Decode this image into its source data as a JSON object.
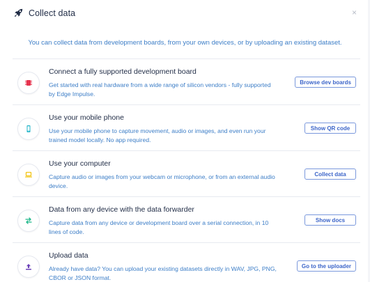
{
  "header": {
    "title": "Collect data",
    "close_glyph": "×",
    "icon": "rocket-icon"
  },
  "intro": "You can collect data from development boards, from your own devices, or by uploading an existing dataset.",
  "options": [
    {
      "title": "Connect a fully supported development board",
      "description": "Get started with real hardware from a wide range of silicon vendors - fully supported by Edge Impulse.",
      "button": "Browse dev boards",
      "icon": "chip-icon",
      "icon_color": "#e6334e"
    },
    {
      "title": "Use your mobile phone",
      "description": "Use your mobile phone to capture movement, audio or images, and even run your trained model locally. No app required.",
      "button": "Show QR code",
      "icon": "phone-icon",
      "icon_color": "#21b5c9"
    },
    {
      "title": "Use your computer",
      "description": "Capture audio or images from your webcam or microphone, or from an external audio device.",
      "button": "Collect data",
      "icon": "laptop-icon",
      "icon_color": "#f2c518"
    },
    {
      "title": "Data from any device with the data forwarder",
      "description": "Capture data from any device or development board over a serial connection, in 10 lines of code.",
      "button": "Show docs",
      "icon": "arrows-exchange-icon",
      "icon_color": "#1fb88a"
    },
    {
      "title": "Upload data",
      "description": "Already have data? You can upload your existing datasets directly in WAV, JPG, PNG, CBOR or JSON format.",
      "button": "Go to the uploader",
      "icon": "upload-icon",
      "icon_color": "#6a3fb8"
    }
  ]
}
